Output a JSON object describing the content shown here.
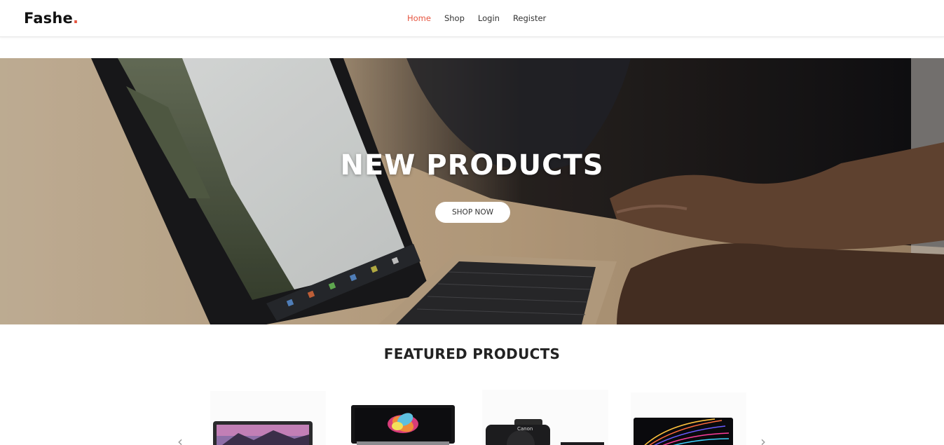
{
  "header": {
    "logo_text": "Fashe",
    "logo_dot": ".",
    "nav": [
      {
        "label": "Home",
        "active": true
      },
      {
        "label": "Shop",
        "active": false
      },
      {
        "label": "Login",
        "active": false
      },
      {
        "label": "Register",
        "active": false
      }
    ]
  },
  "hero": {
    "title": "NEW PRODUCTS",
    "button_label": "SHOP NOW"
  },
  "featured": {
    "title": "FEATURED PRODUCTS",
    "prev_icon": "chevron-left-icon",
    "next_icon": "chevron-right-icon",
    "prev_glyph": "‹",
    "next_glyph": "›"
  },
  "colors": {
    "accent": "#e65540",
    "text": "#222222",
    "nav_text": "#333333"
  }
}
